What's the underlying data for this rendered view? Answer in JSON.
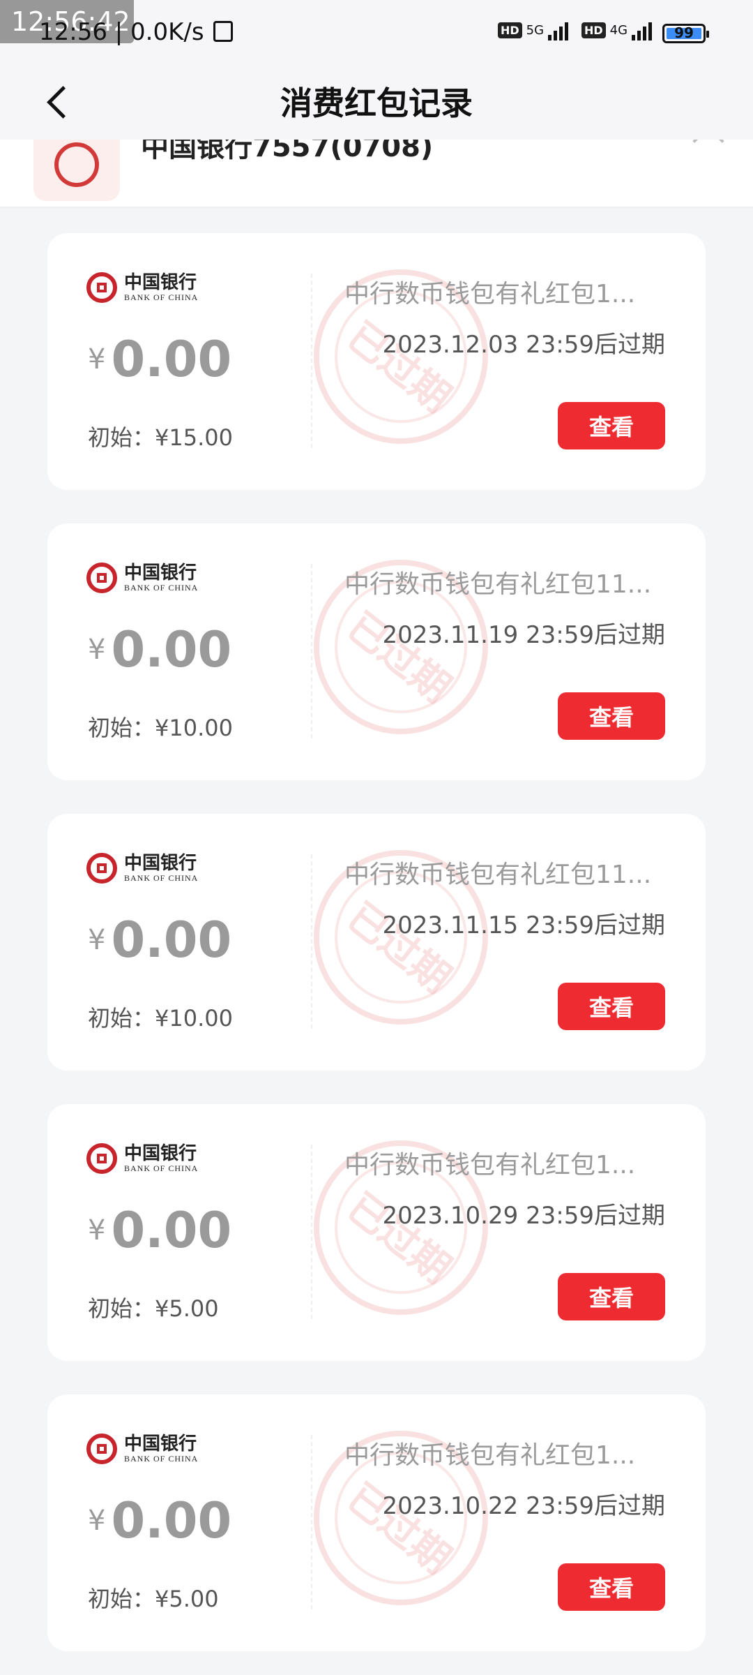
{
  "status_bar": {
    "clock": "12:56:42",
    "network": "12:56 | 0.0K/s",
    "signal1": "5G",
    "signal2": "4G",
    "hd": "HD",
    "battery": "99",
    "battery_level": 0.99
  },
  "header": {
    "title": "消费红包记录"
  },
  "account": {
    "name": "中国银行7557(0708)"
  },
  "brand": {
    "cn": "中国银行",
    "en": "BANK OF CHINA"
  },
  "stamp_text": "已过期",
  "view_label": "查看",
  "currency": "¥",
  "coupons": [
    {
      "amount": "0.00",
      "initial": "初始：¥15.00",
      "name": "中行数币钱包有礼红包1...",
      "expire": "2023.12.03 23:59后过期"
    },
    {
      "amount": "0.00",
      "initial": "初始：¥10.00",
      "name": "中行数币钱包有礼红包11...",
      "expire": "2023.11.19 23:59后过期"
    },
    {
      "amount": "0.00",
      "initial": "初始：¥10.00",
      "name": "中行数币钱包有礼红包11...",
      "expire": "2023.11.15 23:59后过期"
    },
    {
      "amount": "0.00",
      "initial": "初始：¥5.00",
      "name": "中行数币钱包有礼红包1...",
      "expire": "2023.10.29 23:59后过期"
    },
    {
      "amount": "0.00",
      "initial": "初始：¥5.00",
      "name": "中行数币钱包有礼红包1...",
      "expire": "2023.10.22 23:59后过期"
    }
  ],
  "colors": {
    "accent_red": "#ee2b31",
    "brand_red": "#c8242c"
  }
}
